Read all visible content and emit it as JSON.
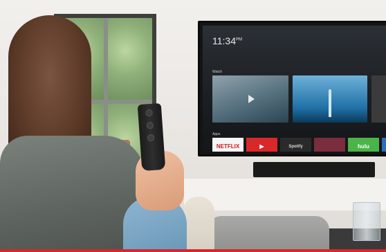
{
  "tv": {
    "clock_time": "11:34",
    "clock_suffix": "PM",
    "rows": [
      {
        "label": "Watch"
      },
      {
        "label": "Apps"
      }
    ],
    "apps": [
      {
        "label": "NETFLIX",
        "icon": "netflix-logo"
      },
      {
        "label": "▶",
        "icon": "youtube-play-icon"
      },
      {
        "label": "Spotify",
        "icon": "spotify-logo"
      },
      {
        "label": "",
        "icon": "movies-tile"
      },
      {
        "label": "hulu",
        "icon": "hulu-logo"
      },
      {
        "label": "",
        "icon": "more-tile"
      }
    ]
  },
  "colors": {
    "accent_bar": "#d7262c",
    "netflix_red": "#d6171f",
    "youtube_red": "#d9282a",
    "hulu_green": "#4ab44a"
  }
}
